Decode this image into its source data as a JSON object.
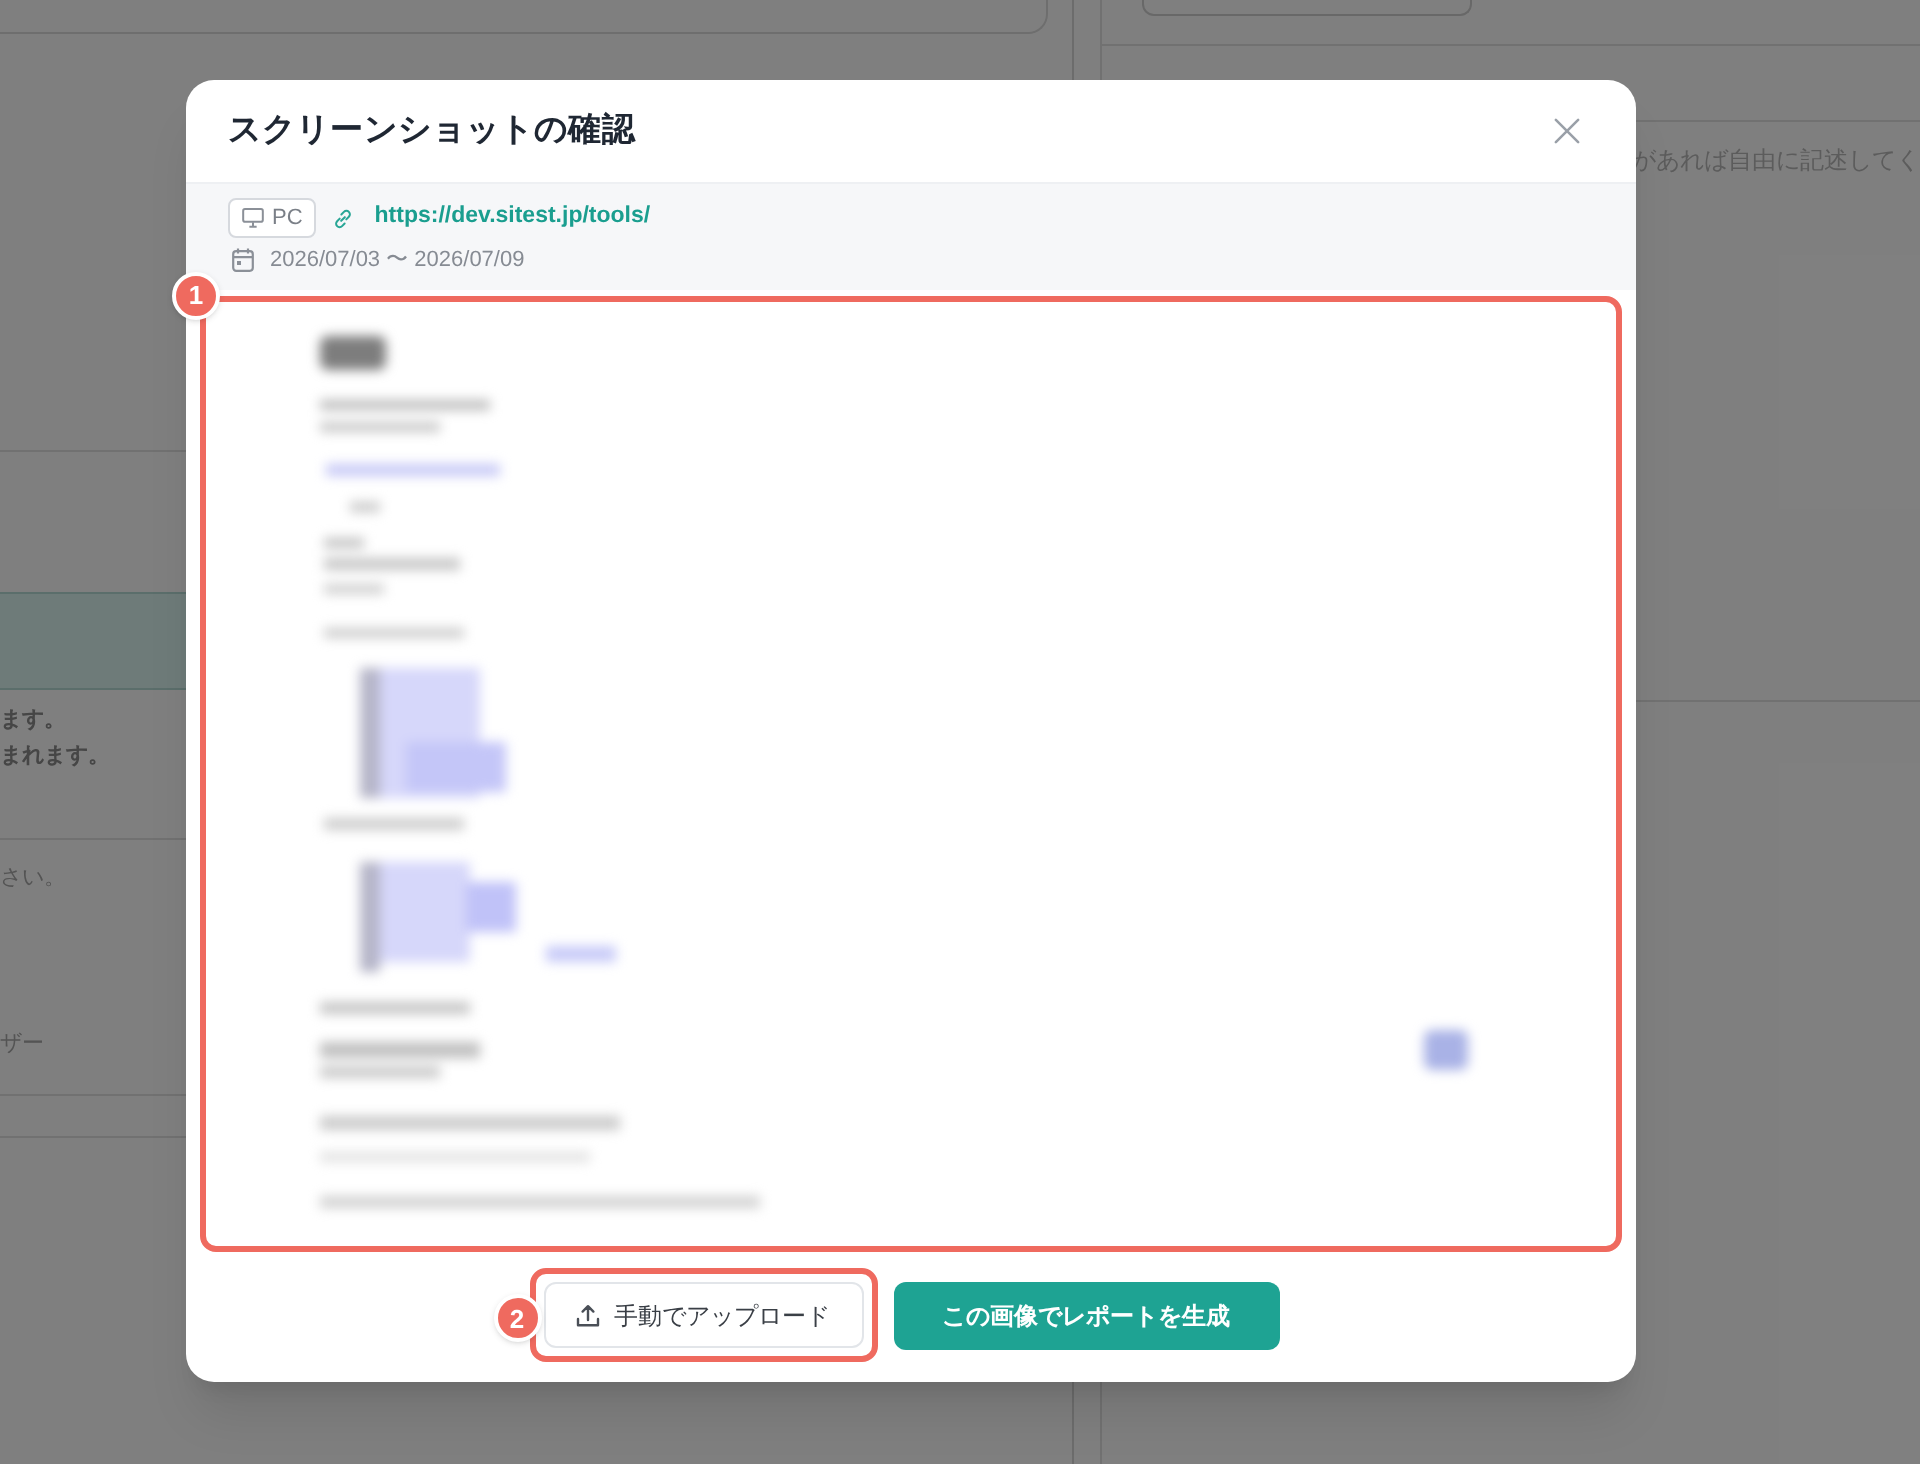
{
  "background_page": {
    "left_texts": [
      {
        "kind": "strong",
        "text": "ます。"
      },
      {
        "kind": "strong",
        "text": "まれます。"
      },
      {
        "kind": "plain",
        "text": "さい。"
      },
      {
        "kind": "plain",
        "text": "ザー"
      }
    ],
    "right_texts": [
      "があれば自由に記述してく"
    ]
  },
  "dialog": {
    "title": "スクリーンショットの確認",
    "device_badge": "PC",
    "url": "https://dev.sitest.jp/tools/",
    "date_range": "2026/07/03 〜 2026/07/09",
    "preview": {
      "annotation": "1"
    },
    "buttons": [
      {
        "kind": "outline",
        "label": "手動でアップロード",
        "annotation": "2"
      },
      {
        "kind": "primary",
        "label": "この画像でレポートを生成"
      }
    ]
  }
}
